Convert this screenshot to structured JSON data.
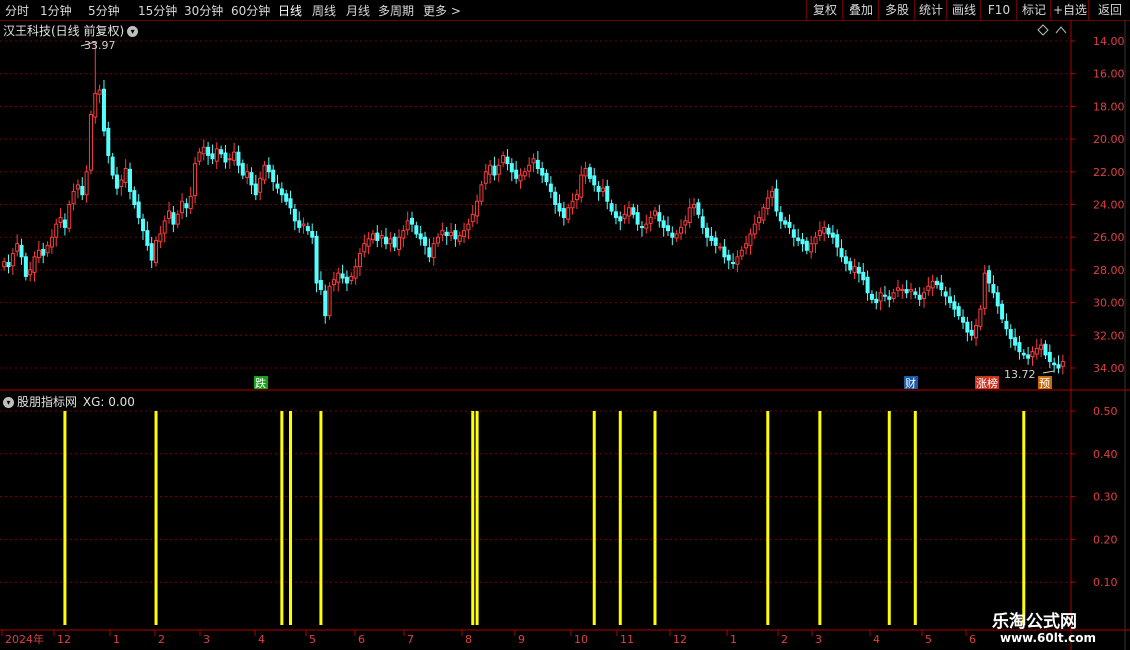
{
  "toolbar": {
    "left_items": [
      "分时",
      "1分钟",
      "5分钟",
      "15分钟",
      "30分钟",
      "60分钟",
      "日线",
      "周线",
      "月线",
      "多周期",
      "更多 >"
    ],
    "active_index": 6,
    "right_items": [
      "复权",
      "叠加",
      "多股",
      "统计",
      "画线",
      "F10",
      "标记",
      "+自选",
      "返回"
    ]
  },
  "main_panel": {
    "title": "汉王科技(日线 前复权)",
    "high_label": "33.97",
    "low_label": "13.72",
    "markers": [
      {
        "text": "跌",
        "color": "#1aa01a"
      },
      {
        "text": "财",
        "color": "#1a5aa8"
      },
      {
        "text": "涨榜",
        "color": "#c83020"
      },
      {
        "text": "预",
        "color": "#c86a10"
      }
    ],
    "diamond_icon": "diamond-icon",
    "y_ticks": [
      "34.00",
      "32.00",
      "30.00",
      "28.00",
      "26.00",
      "24.00",
      "22.00",
      "20.00",
      "18.00",
      "16.00",
      "14.00"
    ]
  },
  "indicator_panel": {
    "title": "股朋指标网",
    "value_label": "XG: 0.00",
    "y_ticks": [
      "0.50",
      "0.40",
      "0.30",
      "0.20",
      "0.10"
    ]
  },
  "x_axis": {
    "labels": [
      "2024年",
      "12",
      "1",
      "2",
      "3",
      "4",
      "5",
      "6",
      "7",
      "8",
      "9",
      "10",
      "11",
      "12",
      "1",
      "2",
      "3",
      "4",
      "5",
      "6"
    ]
  },
  "watermark": {
    "line1": "乐淘公式网",
    "line2": "www.60lt.com"
  },
  "colors": {
    "up": "#ff3c3c",
    "down": "#54ffff",
    "signal": "#ffff00",
    "grid": "#7a0000",
    "axis": "#b00000"
  },
  "chart_data": [
    {
      "type": "candlestick",
      "title": "汉王科技(日线 前复权)",
      "ylim": [
        13,
        35
      ],
      "y_ticks": [
        14,
        16,
        18,
        20,
        22,
        24,
        26,
        28,
        30,
        32,
        34
      ],
      "annotations": [
        {
          "label": "33.97",
          "kind": "high"
        },
        {
          "label": "13.72",
          "kind": "low"
        }
      ],
      "close_series": [
        20.5,
        20.2,
        21.0,
        21.6,
        20.8,
        19.6,
        20.0,
        20.8,
        21.2,
        20.9,
        21.5,
        22.0,
        22.8,
        23.2,
        22.6,
        24.0,
        24.8,
        25.2,
        24.6,
        26.0,
        29.5,
        30.8,
        31.0,
        28.5,
        27.0,
        25.8,
        25.0,
        25.5,
        26.2,
        24.8,
        24.0,
        23.2,
        22.4,
        21.5,
        20.6,
        21.8,
        22.2,
        23.0,
        23.6,
        22.8,
        23.4,
        24.2,
        23.8,
        24.5,
        26.5,
        27.2,
        27.5,
        27.0,
        26.8,
        27.4,
        27.1,
        26.6,
        26.8,
        27.2,
        26.4,
        25.8,
        26.0,
        25.2,
        24.6,
        25.6,
        26.4,
        26.0,
        25.4,
        25.0,
        24.6,
        24.2,
        23.8,
        23.0,
        22.6,
        22.8,
        22.4,
        22.0,
        19.2,
        18.8,
        17.2,
        19.0,
        19.4,
        19.8,
        19.5,
        19.2,
        19.6,
        20.2,
        21.0,
        21.6,
        21.9,
        22.2,
        21.8,
        22.1,
        21.6,
        21.9,
        21.4,
        22.0,
        22.4,
        23.0,
        22.8,
        22.2,
        21.9,
        21.5,
        20.8,
        21.6,
        22.0,
        22.4,
        22.1,
        22.3,
        21.9,
        22.1,
        22.4,
        22.8,
        23.4,
        24.2,
        25.2,
        26.0,
        26.4,
        25.8,
        26.4,
        27.0,
        26.5,
        26.0,
        25.6,
        25.8,
        26.0,
        26.4,
        26.8,
        26.2,
        25.8,
        25.4,
        24.8,
        24.0,
        23.6,
        23.2,
        23.8,
        24.2,
        24.6,
        25.8,
        26.2,
        25.6,
        25.2,
        24.8,
        25.0,
        24.2,
        23.6,
        23.2,
        23.0,
        23.4,
        23.8,
        23.4,
        22.8,
        22.6,
        22.8,
        23.2,
        23.6,
        23.0,
        22.6,
        22.4,
        22.0,
        22.2,
        22.6,
        23.0,
        23.8,
        24.0,
        23.4,
        22.6,
        22.0,
        21.8,
        21.5,
        21.4,
        20.8,
        20.6,
        20.4,
        20.8,
        21.2,
        21.6,
        22.2,
        22.8,
        23.2,
        23.8,
        24.4,
        24.8,
        23.6,
        23.0,
        22.8,
        22.6,
        22.0,
        21.8,
        21.6,
        21.2,
        21.6,
        22.0,
        22.4,
        22.6,
        22.2,
        22.0,
        21.4,
        20.8,
        20.4,
        20.0,
        20.2,
        19.8,
        19.4,
        18.6,
        18.2,
        18.0,
        18.6,
        18.4,
        18.2,
        18.6,
        18.9,
        18.8,
        18.6,
        18.8,
        18.5,
        18.2,
        18.6,
        19.0,
        19.3,
        19.1,
        18.8,
        18.4,
        18.0,
        17.6,
        17.2,
        16.8,
        16.2,
        16.0,
        16.6,
        17.6,
        19.8,
        19.2,
        18.6,
        17.8,
        17.0,
        16.4,
        15.8,
        15.4,
        15.0,
        14.8,
        14.6,
        15.0,
        15.2,
        15.4,
        14.8,
        14.4,
        14.2,
        14.0,
        14.4
      ]
    },
    {
      "type": "bar",
      "title": "股朋指标网",
      "series": [
        {
          "name": "XG",
          "values": []
        }
      ],
      "ylim": [
        0,
        0.55
      ],
      "y_ticks": [
        0.1,
        0.2,
        0.3,
        0.4,
        0.5
      ],
      "signal_value": 0.5,
      "signal_indices": [
        14,
        35,
        64,
        66,
        73,
        108,
        109,
        136,
        142,
        150,
        176,
        188,
        204,
        210,
        235
      ]
    }
  ]
}
